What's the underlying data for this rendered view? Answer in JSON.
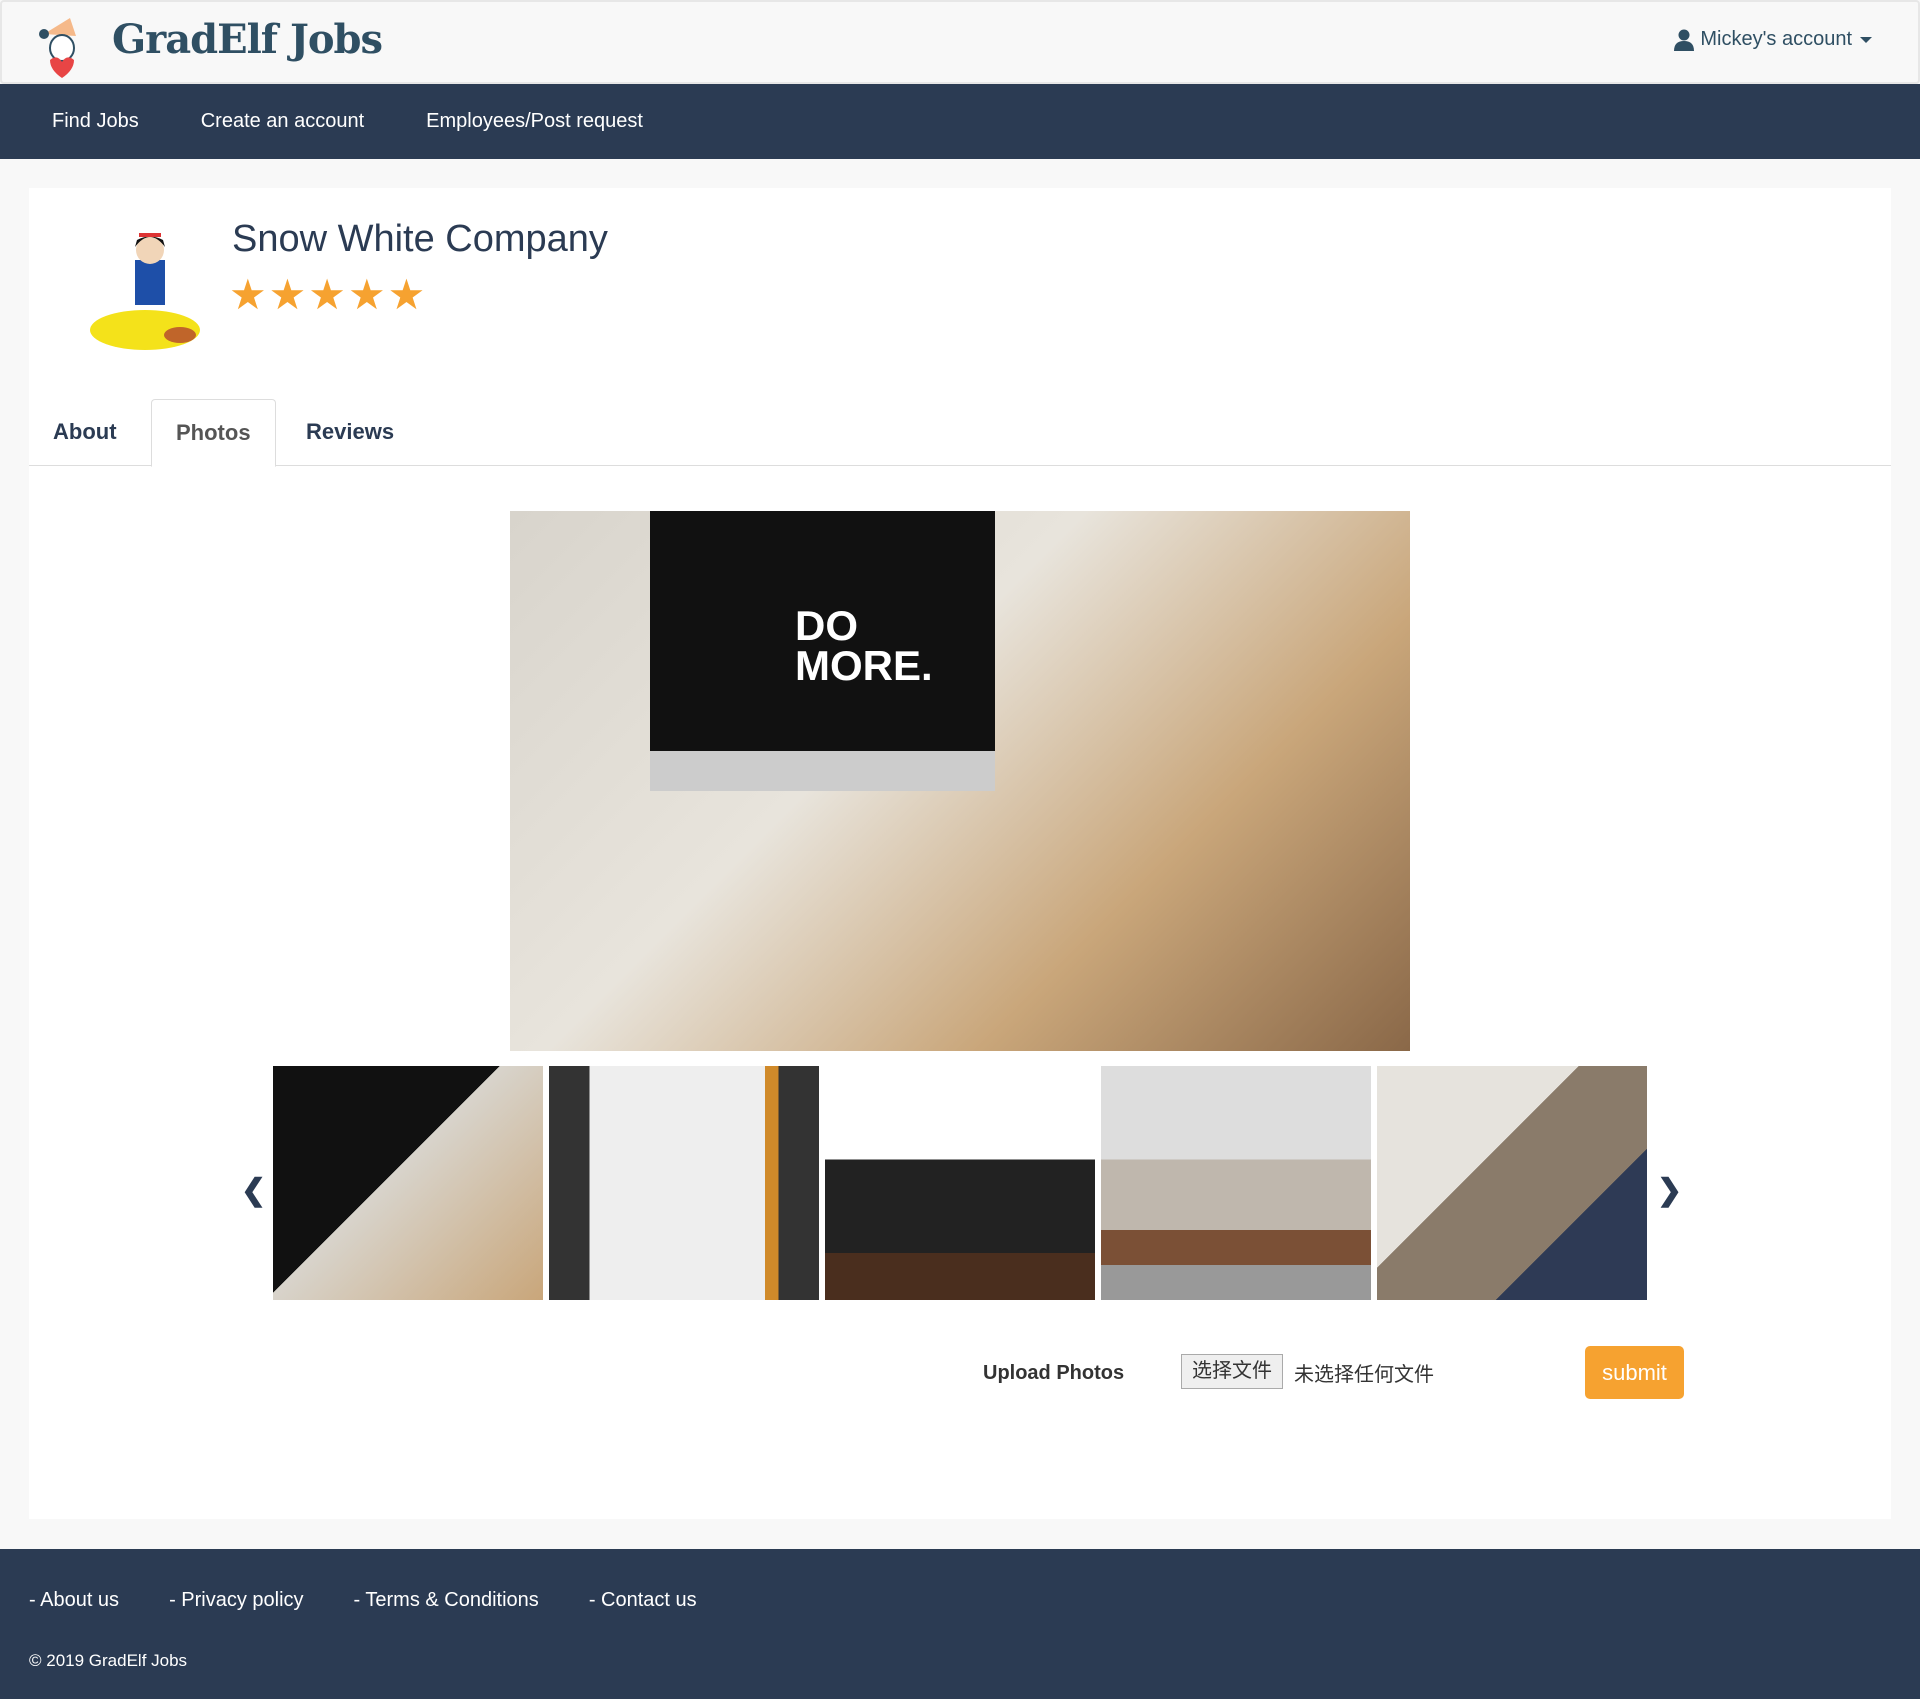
{
  "header": {
    "brand": "GradElf Jobs",
    "account": "Mickey's account",
    "account_icon": "user-icon"
  },
  "nav": {
    "items": [
      "Find Jobs",
      "Create an account",
      "Employees/Post request"
    ]
  },
  "company": {
    "name": "Snow White Company",
    "rating": 5,
    "rating_max": 5,
    "stars": "★★★★★"
  },
  "tabs": [
    {
      "label": "About"
    },
    {
      "label": "Photos",
      "active": true
    },
    {
      "label": "Reviews"
    }
  ],
  "gallery": {
    "main_text": "DO MORE.",
    "thumbnails": 5,
    "prev_icon": "chevron-left-icon",
    "next_icon": "chevron-right-icon"
  },
  "upload": {
    "label": "Upload Photos",
    "file_button": "选择文件",
    "file_status": "未选择任何文件",
    "submit": "submit"
  },
  "footer": {
    "links": [
      "- About us",
      "- Privacy policy",
      "- Terms & Conditions",
      "- Contact us"
    ],
    "copyright": "© 2019 GradElf Jobs"
  },
  "colors": {
    "nav": "#2b3b53",
    "accent": "#f6a230",
    "brand": "#2f4f63"
  }
}
